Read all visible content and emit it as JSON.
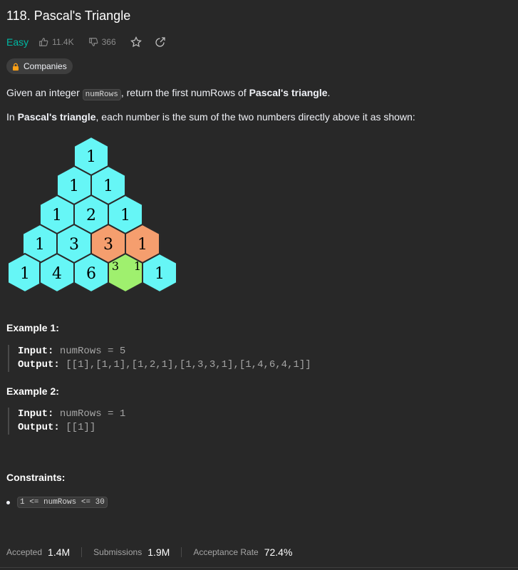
{
  "problem": {
    "title": "118. Pascal's Triangle",
    "difficulty": "Easy",
    "likes": "11.4K",
    "dislikes": "366",
    "companies_label": "Companies"
  },
  "description": {
    "p1_before": "Given an integer ",
    "p1_code": "numRows",
    "p1_middle": ", return the first numRows of ",
    "p1_bold": "Pascal's triangle",
    "p1_after": ".",
    "p2_before": "In ",
    "p2_bold": "Pascal's triangle",
    "p2_after": ", each number is the sum of the two numbers directly above it as shown:"
  },
  "triangle": {
    "rows": [
      [
        "1"
      ],
      [
        "1",
        "1"
      ],
      [
        "1",
        "2",
        "1"
      ],
      [
        "1",
        "3",
        "3",
        "1"
      ],
      [
        "1",
        "4",
        "6",
        "3",
        "1",
        "1"
      ]
    ],
    "colors": {
      "cyan": "#66f6f6",
      "orange": "#f59e6e",
      "green": "#9ff06e",
      "stroke": "#2a2a2a"
    }
  },
  "examples": [
    {
      "title": "Example 1:",
      "input_label": "Input:",
      "input_value": "numRows = 5",
      "output_label": "Output:",
      "output_value": "[[1],[1,1],[1,2,1],[1,3,3,1],[1,4,6,4,1]]"
    },
    {
      "title": "Example 2:",
      "input_label": "Input:",
      "input_value": "numRows = 1",
      "output_label": "Output:",
      "output_value": "[[1]]"
    }
  ],
  "constraints": {
    "title": "Constraints:",
    "items": [
      "1 <= numRows <= 30"
    ]
  },
  "stats": {
    "accepted_label": "Accepted",
    "accepted_value": "1.4M",
    "submissions_label": "Submissions",
    "submissions_value": "1.9M",
    "rate_label": "Acceptance Rate",
    "rate_value": "72.4%"
  },
  "icons": [
    "thumbs-up-icon",
    "thumbs-down-icon",
    "star-icon",
    "share-icon",
    "lock-icon"
  ]
}
